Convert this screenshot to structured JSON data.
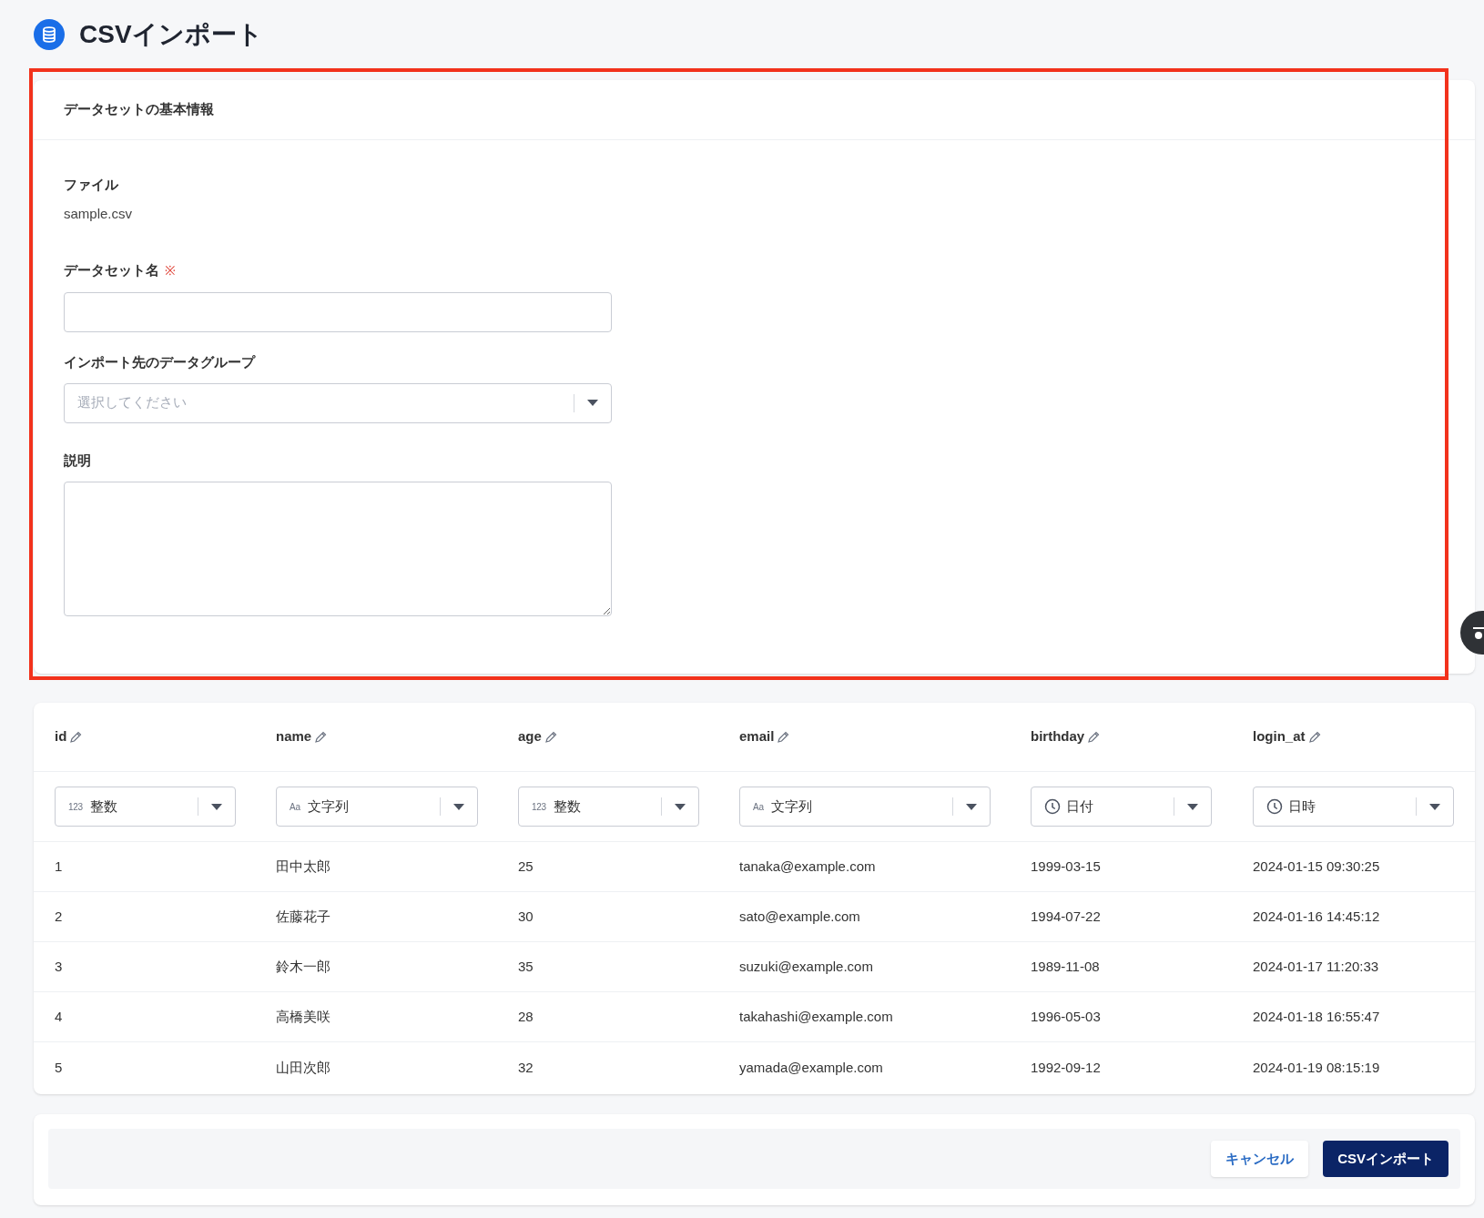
{
  "page": {
    "title": "CSVインポート"
  },
  "basic_info": {
    "heading": "データセットの基本情報",
    "file": {
      "label": "ファイル",
      "value": "sample.csv"
    },
    "dataset_name": {
      "label": "データセット名",
      "required_mark": "※"
    },
    "data_group": {
      "label": "インポート先のデータグループ",
      "placeholder": "選択してください"
    },
    "description": {
      "label": "説明"
    }
  },
  "table": {
    "columns": [
      {
        "name": "id",
        "type": {
          "kind": "glyph",
          "glyph": "123",
          "label": "整数"
        }
      },
      {
        "name": "name",
        "type": {
          "kind": "glyph",
          "glyph": "Aa",
          "label": "文字列"
        }
      },
      {
        "name": "age",
        "type": {
          "kind": "glyph",
          "glyph": "123",
          "label": "整数"
        }
      },
      {
        "name": "email",
        "type": {
          "kind": "glyph",
          "glyph": "Aa",
          "label": "文字列"
        }
      },
      {
        "name": "birthday",
        "type": {
          "kind": "clock",
          "label": "日付"
        }
      },
      {
        "name": "login_at",
        "type": {
          "kind": "clock",
          "label": "日時"
        }
      }
    ],
    "rows": [
      [
        "1",
        "田中太郎",
        "25",
        "tanaka@example.com",
        "1999-03-15",
        "2024-01-15 09:30:25"
      ],
      [
        "2",
        "佐藤花子",
        "30",
        "sato@example.com",
        "1994-07-22",
        "2024-01-16 14:45:12"
      ],
      [
        "3",
        "鈴木一郎",
        "35",
        "suzuki@example.com",
        "1989-11-08",
        "2024-01-17 11:20:33"
      ],
      [
        "4",
        "高橋美咲",
        "28",
        "takahashi@example.com",
        "1996-05-03",
        "2024-01-18 16:55:47"
      ],
      [
        "5",
        "山田次郎",
        "32",
        "yamada@example.com",
        "1992-09-12",
        "2024-01-19 08:15:19"
      ]
    ]
  },
  "footer": {
    "buttons": [
      {
        "kind": "secondary",
        "label": "キャンセル"
      },
      {
        "kind": "primary",
        "label": "CSVインポート"
      }
    ]
  }
}
